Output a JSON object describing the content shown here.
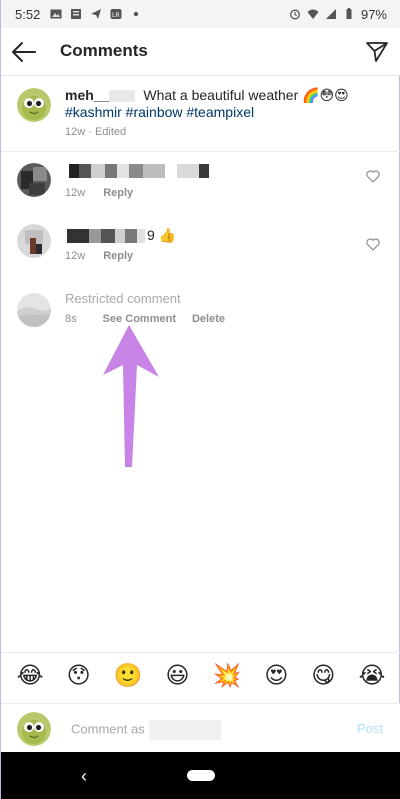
{
  "status": {
    "time": "5:52",
    "battery": "97%"
  },
  "header": {
    "title": "Comments"
  },
  "caption": {
    "username": "meh__",
    "text": "What a beautiful weather 🌈😳😍",
    "hashtags": "#kashmir #rainbow #teampixel",
    "time": "12w",
    "edited": "· Edited"
  },
  "comments": [
    {
      "time": "12w",
      "reply": "Reply"
    },
    {
      "text_tail": "9 👍",
      "time": "12w",
      "reply": "Reply"
    }
  ],
  "restricted": {
    "label": "Restricted comment",
    "time": "8s",
    "see": "See Comment",
    "delete": "Delete"
  },
  "emojis": [
    "😂",
    "😯",
    "🙂",
    "😃",
    "💥",
    "😍",
    "😋",
    "😭"
  ],
  "composer": {
    "placeholder": "Comment as",
    "post": "Post"
  },
  "colors": {
    "arrow": "#c784e6",
    "link": "#003569",
    "post": "#b2dffc"
  }
}
